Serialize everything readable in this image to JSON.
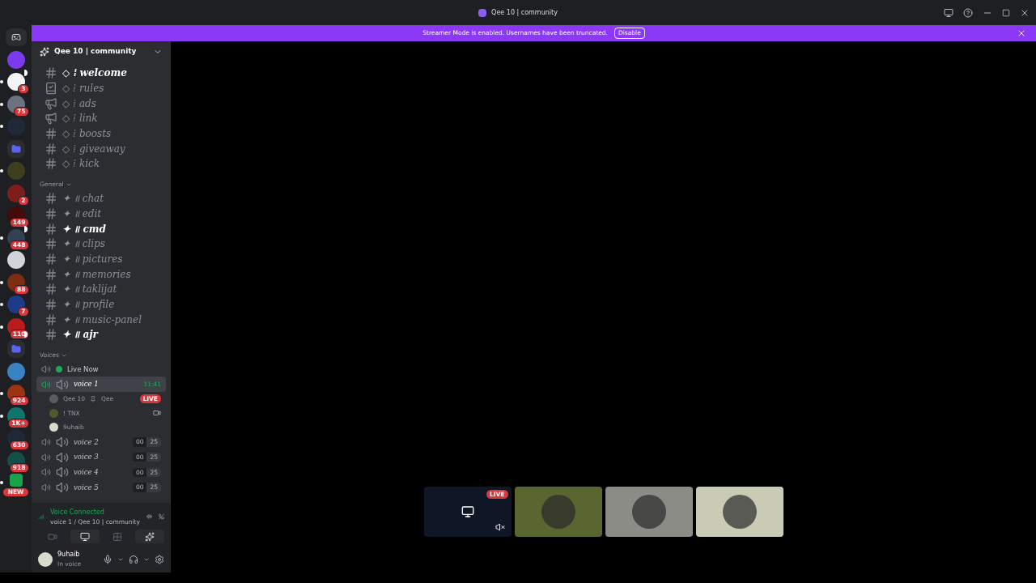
{
  "window": {
    "title": "Qee 10 | community"
  },
  "banner": {
    "text": "Streamer Mode is enabled. Usernames have been truncated.",
    "button": "Disable"
  },
  "servers": [
    {
      "color": "#7c3aed",
      "unread": false
    },
    {
      "badge": "3",
      "color": "#f3f4f6",
      "unread": true
    },
    {
      "badge": "75",
      "color": "#6b7280",
      "unread": true
    },
    {
      "color": "#1f2937",
      "unread": true
    },
    {
      "color": "#5865f2",
      "unread": false,
      "kind": "folder"
    },
    {
      "color": "#3f3f1f",
      "unread": true
    },
    {
      "badge": "2",
      "color": "#7f1d1d",
      "unread": false
    },
    {
      "badge": "149",
      "color": "#450a0a",
      "unread": false
    },
    {
      "badge": "448",
      "color": "#334155",
      "unread": true
    },
    {
      "color": "#d1d5db",
      "unread": false
    },
    {
      "badge": "88",
      "color": "#7c2d12",
      "unread": true
    },
    {
      "badge": "7",
      "color": "#1e3a8a",
      "unread": true
    },
    {
      "badge": "110",
      "color": "#b91c1c",
      "unread": true
    },
    {
      "color": "#5865f2",
      "unread": false,
      "kind": "folder"
    },
    {
      "color": "#3b82c4",
      "unread": false
    },
    {
      "badge": "924",
      "color": "#9a3412",
      "unread": true
    },
    {
      "badge": "1K+",
      "color": "#0f766e",
      "unread": true
    },
    {
      "badge": "630",
      "color": "#1f2937",
      "unread": false
    },
    {
      "badge": "918",
      "color": "#134e4a",
      "unread": false
    },
    {
      "badge": "NEW",
      "color": "#16a34a",
      "unread": true,
      "kind": "new"
    }
  ],
  "server_header": {
    "name": "Qee 10 | community"
  },
  "channels": [
    {
      "kind": "text",
      "prefix": "◇ ⁞",
      "name": "welcome",
      "unread": true
    },
    {
      "kind": "rules",
      "prefix": "◇ ⁞",
      "name": "rules",
      "unread": false
    },
    {
      "kind": "announce",
      "prefix": "◇ ⁞",
      "name": "ads",
      "unread": false
    },
    {
      "kind": "announce",
      "prefix": "◇ ⁞",
      "name": "link",
      "unread": false
    },
    {
      "kind": "text",
      "prefix": "◇ ⁞",
      "name": "boosts",
      "unread": false
    },
    {
      "kind": "text",
      "prefix": "◇ ⁞",
      "name": "giveaway",
      "unread": false
    },
    {
      "kind": "text",
      "prefix": "◇ ⁞",
      "name": "kick",
      "unread": false
    }
  ],
  "categories": [
    {
      "name": "General",
      "channels": [
        {
          "kind": "text",
          "prefix": "✦ ॥",
          "name": "chat",
          "unread": false
        },
        {
          "kind": "text",
          "prefix": "✦ ॥",
          "name": "edit",
          "unread": false
        },
        {
          "kind": "text",
          "prefix": "✦ ॥",
          "name": "cmd",
          "unread": true
        },
        {
          "kind": "text",
          "prefix": "✦ ॥",
          "name": "clips",
          "unread": false
        },
        {
          "kind": "text",
          "prefix": "✦ ॥",
          "name": "pictures",
          "unread": false
        },
        {
          "kind": "text",
          "prefix": "✦ ॥",
          "name": "memories",
          "unread": false
        },
        {
          "kind": "text",
          "prefix": "✦ ॥",
          "name": "taklijat",
          "unread": false
        },
        {
          "kind": "text",
          "prefix": "✦ ॥",
          "name": "profile",
          "unread": false
        },
        {
          "kind": "text",
          "prefix": "✦ ॥",
          "name": "music-panel",
          "unread": false
        },
        {
          "kind": "text",
          "prefix": "✦ ॥",
          "name": "ajr",
          "unread": true
        }
      ]
    }
  ],
  "voices": {
    "name": "Voices",
    "channels": [
      {
        "kind": "stage",
        "name": "Live Now",
        "selected": false
      },
      {
        "kind": "voice",
        "name": "voice 1",
        "selected": true,
        "timer": "11:41",
        "users": [
          {
            "name": "Qee 10",
            "tag": "Qee",
            "live": "LIVE",
            "color": "#5b5b63"
          },
          {
            "name": "! TNX",
            "color": "#4d5a2a"
          },
          {
            "name": "9uhaib",
            "color": "#d6dccb"
          }
        ]
      },
      {
        "kind": "voice",
        "name": "voice 2",
        "selected": false,
        "count": "00",
        "limit": "25"
      },
      {
        "kind": "voice",
        "name": "voice 3",
        "selected": false,
        "count": "00",
        "limit": "25"
      },
      {
        "kind": "voice",
        "name": "voice 4",
        "selected": false,
        "count": "00",
        "limit": "25"
      },
      {
        "kind": "voice",
        "name": "voice 5",
        "selected": false,
        "count": "00",
        "limit": "25"
      }
    ]
  },
  "voice_panel": {
    "status": "Voice Connected",
    "location": "voice 1 / Qee 10 | community"
  },
  "user": {
    "name": "9uhaib",
    "status": "In voice"
  },
  "tiles": [
    {
      "kind": "stream",
      "live": "LIVE",
      "color": "#0f1626"
    },
    {
      "kind": "avatar",
      "color": "#5a6630"
    },
    {
      "kind": "avatar",
      "color": "#8c8c86"
    },
    {
      "kind": "avatar",
      "color": "#c9cbb5"
    }
  ]
}
